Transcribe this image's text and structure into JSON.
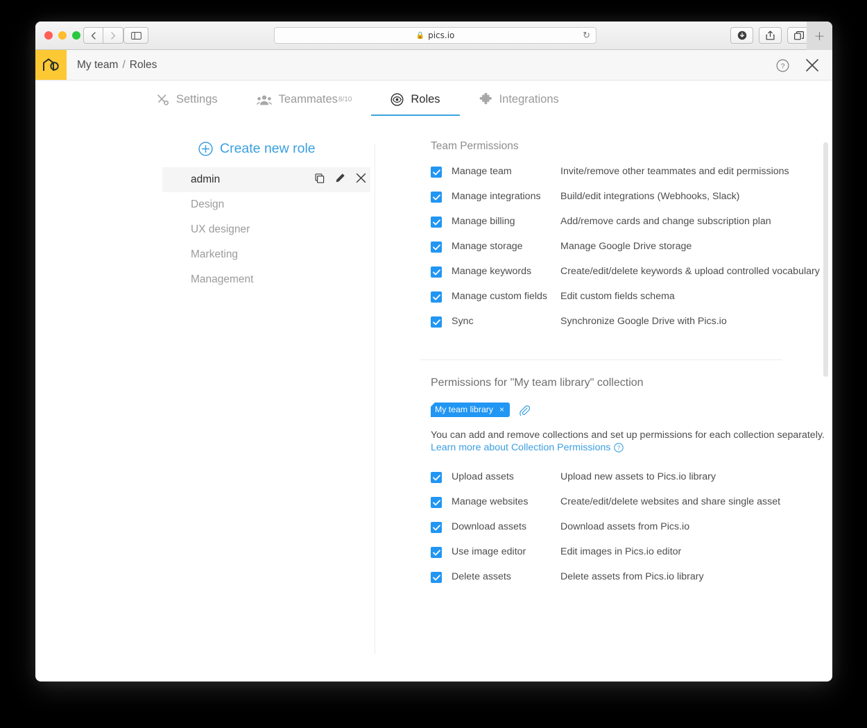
{
  "browser": {
    "url": "pics.io",
    "lock_icon": "lock-icon",
    "back_label": "‹",
    "forward_label": "›",
    "sidebar_icon": "sidebar-toggle-icon",
    "reload_icon": "reload-icon",
    "download_icon": "download-icon",
    "share_icon": "share-icon",
    "tabs_icon": "tab-overview-icon",
    "new_tab_label": "+"
  },
  "header": {
    "logo_name": "picsio-logo",
    "breadcrumb": {
      "team": "My team",
      "separator": "/",
      "page": "Roles"
    },
    "help_icon": "help-icon",
    "close_icon": "close-icon"
  },
  "tabs": [
    {
      "label": "Settings",
      "icon": "tools-icon",
      "sup": "",
      "active": false
    },
    {
      "label": "Teammates",
      "icon": "teammates-icon",
      "sup": "8/10",
      "active": false
    },
    {
      "label": "Roles",
      "icon": "eye-icon",
      "sup": "",
      "active": true
    },
    {
      "label": "Integrations",
      "icon": "puzzle-icon",
      "sup": "",
      "active": false
    }
  ],
  "roles_panel": {
    "create_label": "Create new role",
    "create_icon": "plus-circle-icon",
    "items": [
      {
        "label": "admin",
        "selected": true
      },
      {
        "label": "Design",
        "selected": false
      },
      {
        "label": "UX designer",
        "selected": false
      },
      {
        "label": "Marketing",
        "selected": false
      },
      {
        "label": "Management",
        "selected": false
      }
    ],
    "actions": {
      "copy_icon": "copy-icon",
      "edit_icon": "pencil-icon",
      "delete_icon": "close-icon"
    }
  },
  "team_permissions": {
    "title": "Team Permissions",
    "items": [
      {
        "label": "Manage team",
        "desc": "Invite/remove other teammates and edit permissions",
        "checked": true
      },
      {
        "label": "Manage integrations",
        "desc": "Build/edit integrations (Webhooks, Slack)",
        "checked": true
      },
      {
        "label": "Manage billing",
        "desc": "Add/remove cards and change subscription plan",
        "checked": true
      },
      {
        "label": "Manage storage",
        "desc": "Manage Google Drive storage",
        "checked": true
      },
      {
        "label": "Manage keywords",
        "desc": "Create/edit/delete keywords & upload controlled vocabulary",
        "checked": true
      },
      {
        "label": "Manage custom fields",
        "desc": "Edit custom fields schema",
        "checked": true
      },
      {
        "label": "Sync",
        "desc": "Synchronize Google Drive with Pics.io",
        "checked": true
      }
    ]
  },
  "collection_permissions": {
    "title": "Permissions for \"My team library\" collection",
    "chip": {
      "label": "My team library",
      "remove_label": "×"
    },
    "attach_icon": "paperclip-icon",
    "help_text": "You can add and remove collections and set up permissions for each collection separately.",
    "learn_link": "Learn more about Collection Permissions",
    "learn_icon": "help-icon",
    "items": [
      {
        "label": "Upload assets",
        "desc": "Upload new assets to Pics.io library",
        "checked": true
      },
      {
        "label": "Manage websites",
        "desc": "Create/edit/delete websites and share single asset",
        "checked": true
      },
      {
        "label": "Download assets",
        "desc": "Download assets from Pics.io",
        "checked": true
      },
      {
        "label": "Use image editor",
        "desc": "Edit images in Pics.io editor",
        "checked": true
      },
      {
        "label": "Delete assets",
        "desc": "Delete assets from Pics.io library",
        "checked": true
      }
    ]
  },
  "colors": {
    "accent": "#2196f3",
    "link": "#3b9fe0",
    "logo_bg": "#fcc934",
    "tab_underline": "#3ba3e0"
  }
}
